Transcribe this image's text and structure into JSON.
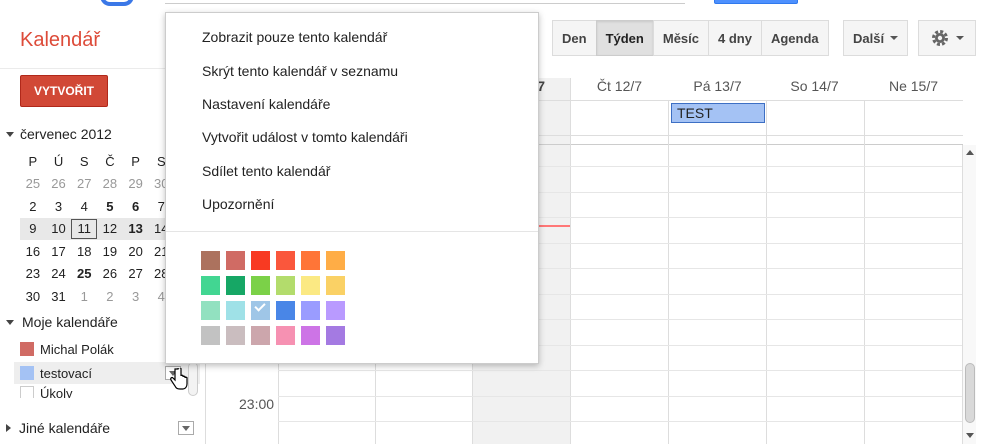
{
  "app": {
    "title": "Kalendář"
  },
  "views": {
    "day": "Den",
    "week": "Týden",
    "month": "Měsíc",
    "four_days": "4 dny",
    "agenda": "Agenda",
    "more": "Další"
  },
  "sidebar": {
    "create_label": "VYTVOŘIT",
    "month_label": "červenec 2012",
    "weekday_headers": [
      "P",
      "Ú",
      "S",
      "Č",
      "P",
      "S"
    ],
    "weeks": [
      [
        "25",
        "26",
        "27",
        "28",
        "29",
        "30"
      ],
      [
        "2",
        "3",
        "4",
        "5",
        "6",
        "7"
      ],
      [
        "9",
        "10",
        "11",
        "12",
        "13",
        "14"
      ],
      [
        "16",
        "17",
        "18",
        "19",
        "20",
        "21"
      ],
      [
        "23",
        "24",
        "25",
        "26",
        "27",
        "28"
      ],
      [
        "30",
        "31",
        "1",
        "2",
        "3",
        "4"
      ]
    ],
    "my_calendars_label": "Moje kalendáře",
    "calendars": [
      {
        "name": "Michal Polák",
        "color": "#d06b64"
      },
      {
        "name": "testovací",
        "color": "#a4c2f4"
      },
      {
        "name": "Úkoly",
        "color": "#ffffff"
      }
    ],
    "other_calendars_label": "Jiné kalendáře"
  },
  "grid": {
    "day_headers": [
      "7",
      "Čt 12/7",
      "Pá 13/7",
      "So 14/7",
      "Ne 15/7"
    ],
    "event": {
      "title": "TEST",
      "color": "#a4c2f4"
    },
    "time_label": "23:00"
  },
  "popup": {
    "items": [
      "Zobrazit pouze tento kalendář",
      "Skrýt tento kalendář v seznamu",
      "Nastavení kalendáře",
      "Vytvořit událost v tomto kalendáři",
      "Sdílet tento kalendář",
      "Upozornění"
    ],
    "palette": [
      [
        "#ac725e",
        "#d06b64",
        "#f83a22",
        "#fa573c",
        "#ff7537",
        "#ffad46"
      ],
      [
        "#42d692",
        "#16a765",
        "#7bd148",
        "#b3dc6c",
        "#fbe983",
        "#fad165"
      ],
      [
        "#92e1c0",
        "#9fe1e7",
        "#9fc6e7",
        "#4986e7",
        "#9a9cff",
        "#b99aff"
      ],
      [
        "#c2c2c2",
        "#cabdbf",
        "#cca6ac",
        "#f691b2",
        "#cd74e6",
        "#a47ae2"
      ]
    ],
    "selected_color": "#9fc6e7"
  },
  "colors": {
    "accent": "#dd4b39",
    "create_button": "#d14836",
    "now_line": "#ff7777"
  }
}
